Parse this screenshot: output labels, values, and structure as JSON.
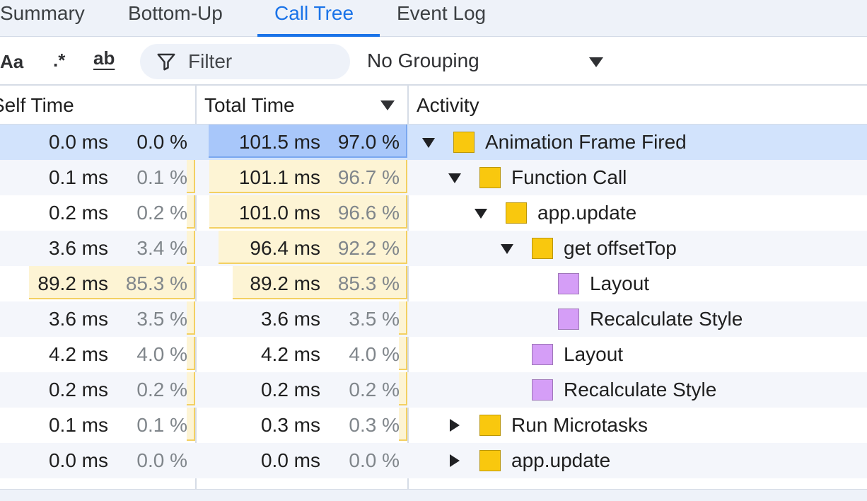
{
  "tabs": [
    {
      "label": "Summary"
    },
    {
      "label": "Bottom-Up"
    },
    {
      "label": "Call Tree"
    },
    {
      "label": "Event Log"
    }
  ],
  "toolbar": {
    "match_case_label": "Aa",
    "regex_label": ".*",
    "whole_word_label": "ab",
    "filter_placeholder": "Filter",
    "grouping_value": "No Grouping"
  },
  "columns": {
    "self_time": "Self Time",
    "total_time": "Total Time",
    "activity": "Activity"
  },
  "colors": {
    "scripting": "#f9c80e",
    "rendering": "#d59ef7",
    "accent": "#1a73e8"
  },
  "rows": [
    {
      "self_ms": "0.0 ms",
      "self_pct": "0.0 %",
      "self_fraction": 0.0,
      "total_ms": "101.5 ms",
      "total_pct": "97.0 %",
      "total_fraction": 0.97,
      "activity": "Animation Frame Fired",
      "category": "scripting",
      "depth": 0,
      "expander": "expanded",
      "selected": true
    },
    {
      "self_ms": "0.1 ms",
      "self_pct": "0.1 %",
      "self_fraction": 0.001,
      "total_ms": "101.1 ms",
      "total_pct": "96.7 %",
      "total_fraction": 0.967,
      "activity": "Function Call",
      "category": "scripting",
      "depth": 1,
      "expander": "expanded"
    },
    {
      "self_ms": "0.2 ms",
      "self_pct": "0.2 %",
      "self_fraction": 0.002,
      "total_ms": "101.0 ms",
      "total_pct": "96.6 %",
      "total_fraction": 0.966,
      "activity": "app.update",
      "category": "scripting",
      "depth": 2,
      "expander": "expanded"
    },
    {
      "self_ms": "3.6 ms",
      "self_pct": "3.4 %",
      "self_fraction": 0.034,
      "total_ms": "96.4 ms",
      "total_pct": "92.2 %",
      "total_fraction": 0.922,
      "activity": "get offsetTop",
      "category": "scripting",
      "depth": 3,
      "expander": "expanded"
    },
    {
      "self_ms": "89.2 ms",
      "self_pct": "85.3 %",
      "self_fraction": 0.853,
      "total_ms": "89.2 ms",
      "total_pct": "85.3 %",
      "total_fraction": 0.853,
      "activity": "Layout",
      "category": "rendering",
      "depth": 4,
      "expander": "none"
    },
    {
      "self_ms": "3.6 ms",
      "self_pct": "3.5 %",
      "self_fraction": 0.035,
      "total_ms": "3.6 ms",
      "total_pct": "3.5 %",
      "total_fraction": 0.035,
      "activity": "Recalculate Style",
      "category": "rendering",
      "depth": 4,
      "expander": "none"
    },
    {
      "self_ms": "4.2 ms",
      "self_pct": "4.0 %",
      "self_fraction": 0.04,
      "total_ms": "4.2 ms",
      "total_pct": "4.0 %",
      "total_fraction": 0.04,
      "activity": "Layout",
      "category": "rendering",
      "depth": 3,
      "expander": "none"
    },
    {
      "self_ms": "0.2 ms",
      "self_pct": "0.2 %",
      "self_fraction": 0.002,
      "total_ms": "0.2 ms",
      "total_pct": "0.2 %",
      "total_fraction": 0.002,
      "activity": "Recalculate Style",
      "category": "rendering",
      "depth": 3,
      "expander": "none"
    },
    {
      "self_ms": "0.1 ms",
      "self_pct": "0.1 %",
      "self_fraction": 0.001,
      "total_ms": "0.3 ms",
      "total_pct": "0.3 %",
      "total_fraction": 0.003,
      "activity": "Run Microtasks",
      "category": "scripting",
      "depth": 1,
      "expander": "collapsed"
    },
    {
      "self_ms": "0.0 ms",
      "self_pct": "0.0 %",
      "self_fraction": 0.0,
      "total_ms": "0.0 ms",
      "total_pct": "0.0 %",
      "total_fraction": 0.0,
      "activity": "app.update",
      "category": "scripting",
      "depth": 1,
      "expander": "collapsed"
    }
  ]
}
